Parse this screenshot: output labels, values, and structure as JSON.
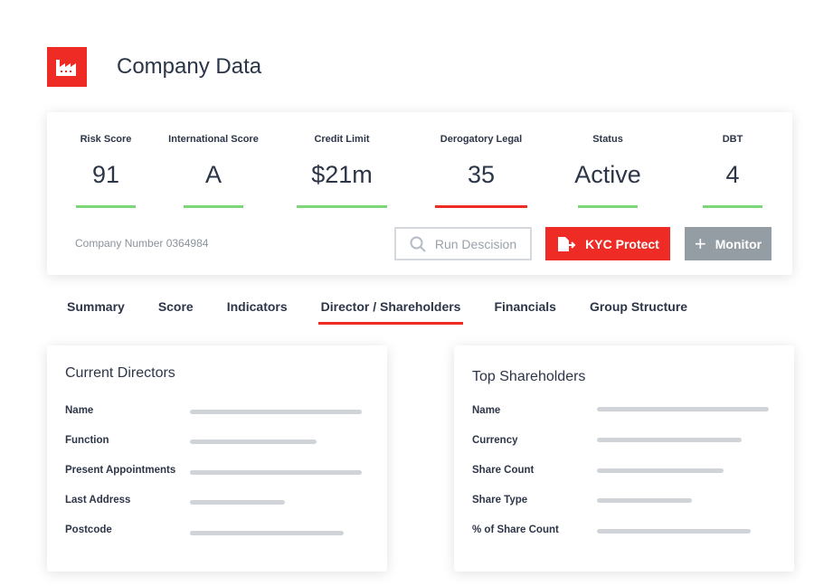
{
  "header": {
    "title": "Company Data",
    "logo_icon": "factory-icon",
    "accent": "#ee2b24"
  },
  "metrics": [
    {
      "label": "Risk Score",
      "value": "91",
      "status_color": "#7ed67a"
    },
    {
      "label": "International Score",
      "value": "A",
      "status_color": "#7ed67a"
    },
    {
      "label": "Credit Limit",
      "value": "$21m",
      "status_color": "#7ed67a"
    },
    {
      "label": "Derogatory Legal",
      "value": "35",
      "status_color": "#ee2b24"
    },
    {
      "label": "Status",
      "value": "Active",
      "status_color": "#7ed67a"
    },
    {
      "label": "DBT",
      "value": "4",
      "status_color": "#7ed67a"
    }
  ],
  "company_number": "Company Number 0364984",
  "buttons": {
    "run": "Run Descision",
    "kyc": "KYC Protect",
    "monitor": "Monitor"
  },
  "tabs": [
    "Summary",
    "Score",
    "Indicators",
    "Director / Shareholders",
    "Financials",
    "Group Structure"
  ],
  "active_tab": "Director / Shareholders",
  "directors": {
    "title": "Current Directors",
    "fields": [
      "Name",
      "Function",
      "Present Appointments",
      "Last Address",
      "Postcode"
    ]
  },
  "shareholders": {
    "title": "Top Shareholders",
    "fields": [
      "Name",
      "Currency",
      "Share Count",
      "Share Type",
      "% of Share Count"
    ]
  }
}
